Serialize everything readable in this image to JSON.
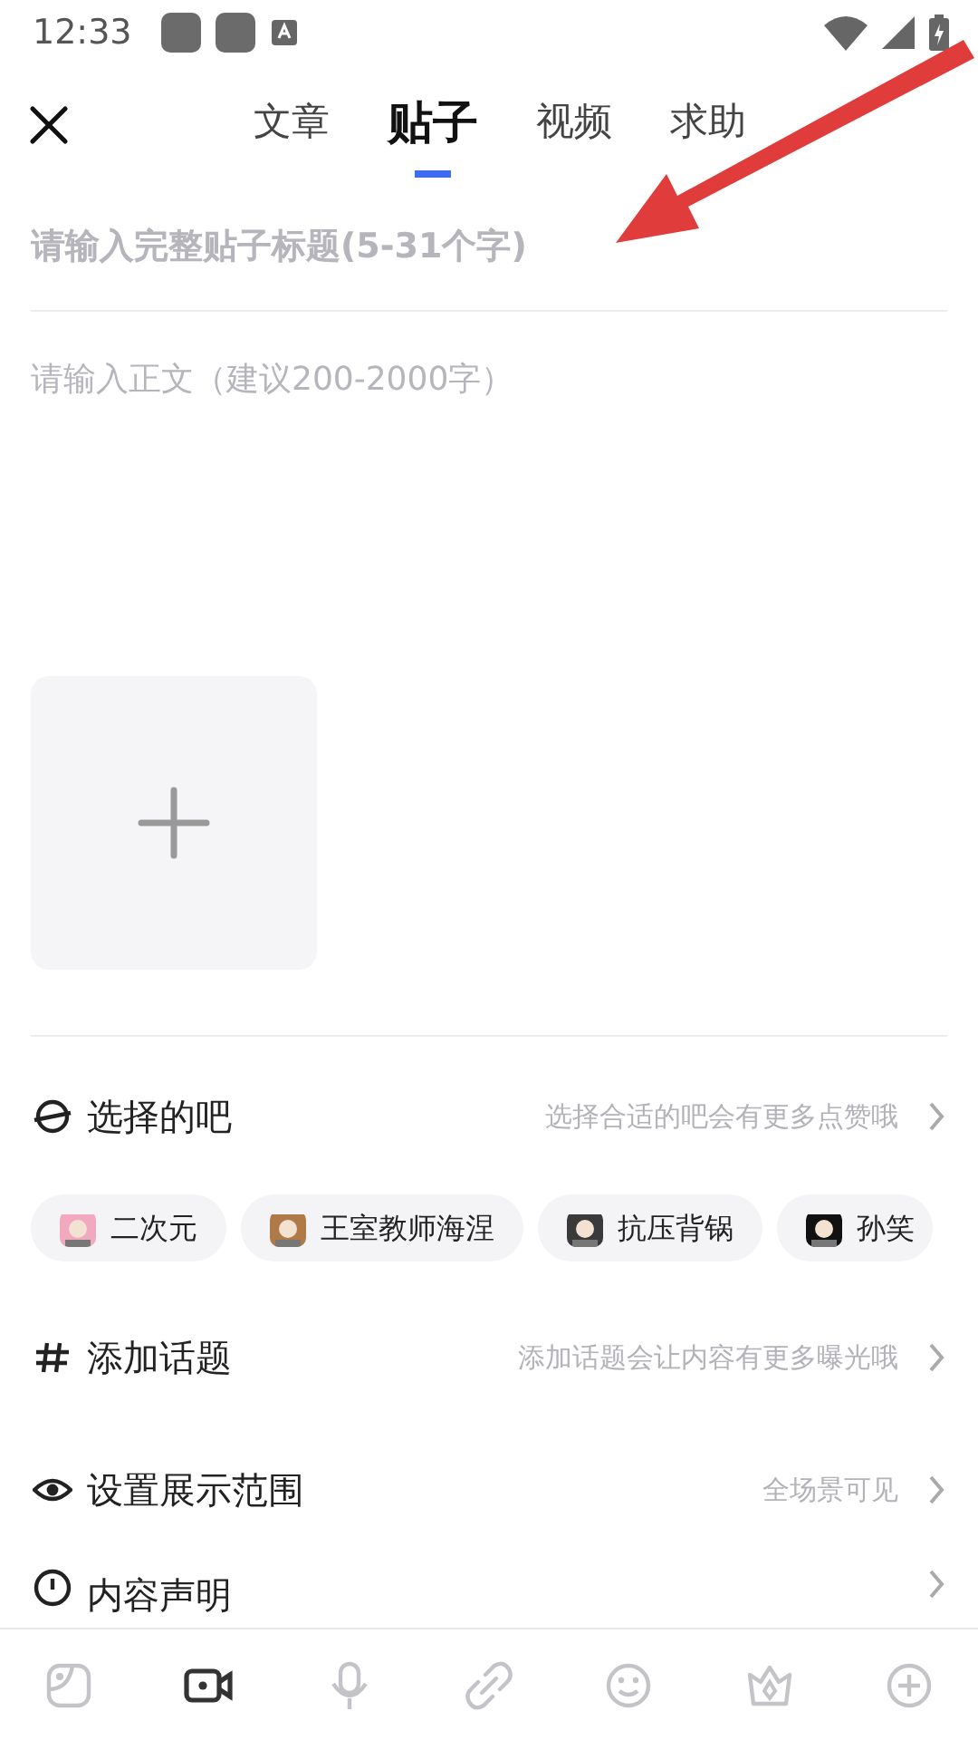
{
  "status_bar": {
    "time": "12:33"
  },
  "tabs": [
    {
      "label": "文章",
      "selected": false
    },
    {
      "label": "贴子",
      "selected": true
    },
    {
      "label": "视频",
      "selected": false
    },
    {
      "label": "求助",
      "selected": false
    }
  ],
  "title_field": {
    "placeholder": "请输入完整贴子标题(5-31个字)"
  },
  "body_field": {
    "placeholder": "请输入正文（建议200-2000字）"
  },
  "settings": [
    {
      "kind": "forum",
      "label": "选择的吧",
      "hint": "选择合适的吧会有更多点赞哦"
    },
    {
      "kind": "chips",
      "chips": [
        {
          "label": "二次元"
        },
        {
          "label": "王室教师海涅"
        },
        {
          "label": "抗压背锅"
        },
        {
          "label": "孙笑"
        }
      ]
    },
    {
      "kind": "topic",
      "label": "添加话题",
      "hint": "添加话题会让内容有更多曝光哦"
    },
    {
      "kind": "visibility",
      "label": "设置展示范围",
      "hint": "全场景可见"
    },
    {
      "kind": "statement",
      "label": "内容声明"
    }
  ],
  "toolbar": [
    {
      "kind": "sticker",
      "active": false
    },
    {
      "kind": "video",
      "active": true
    },
    {
      "kind": "mic",
      "active": false
    },
    {
      "kind": "link",
      "active": false
    },
    {
      "kind": "emoji",
      "active": false
    },
    {
      "kind": "crown",
      "active": false
    },
    {
      "kind": "plus",
      "active": false
    }
  ]
}
